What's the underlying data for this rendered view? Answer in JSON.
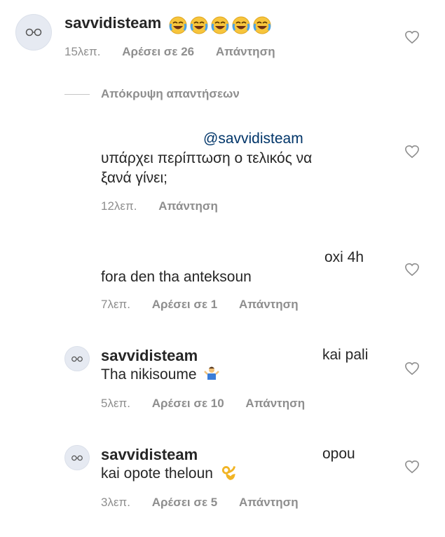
{
  "comments": [
    {
      "username": "savvidisteam",
      "text_line1": "",
      "text_line2": "",
      "time": "15λεπ.",
      "likes": "Αρέσει σε 26",
      "reply": "Απάντηση",
      "emoji": "joy-emoji-x5"
    },
    {
      "mention": "@savvidisteam",
      "text_line1": "υπάρχει περίπτωση ο τελικός να",
      "text_line2": "ξανά γίνει;",
      "time": "12λεπ.",
      "reply": "Απάντηση"
    },
    {
      "text_line1": "oxi 4h",
      "text_line2": "fora den tha anteksoun",
      "time": "7λεπ.",
      "likes": "Αρέσει σε 1",
      "reply": "Απάντηση"
    },
    {
      "username": "savvidisteam",
      "text_line1": "kai pali",
      "text_line2": "Tha nikisoume",
      "time": "5λεπ.",
      "likes": "Αρέσει σε 10",
      "reply": "Απάντηση",
      "emoji": "person-shrugging-emoji"
    },
    {
      "username": "savvidisteam",
      "text_line1": "opou",
      "text_line2": "kai opote theloun",
      "time": "3λεπ.",
      "likes": "Αρέσει σε 5",
      "reply": "Απάντηση",
      "emoji": "ok-hand-emoji"
    }
  ],
  "hide_replies": "Απόκρυψη απαντήσεων",
  "colors": {
    "text": "#262626",
    "meta": "#8e8e8e",
    "mention": "#003569",
    "line": "#c7c7c7"
  }
}
